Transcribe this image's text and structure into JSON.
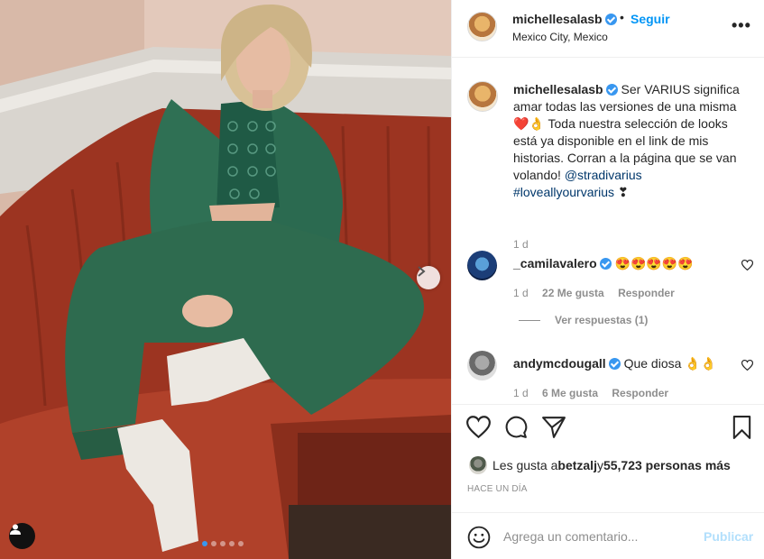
{
  "post": {
    "author": "michellesalasb",
    "location": "Mexico City, Mexico",
    "follow_label": "Seguir",
    "separator": "•",
    "more_label": "•••"
  },
  "caption": {
    "username": "michellesalasb",
    "text": " Ser VARIUS significa amar todas las versiones de una misma ❤️👌 Toda nuestra selección de looks está ya disponible en el link de mis historias. Corran a la página que se van volando! ",
    "mention": "@stradivarius",
    "hashtag": "#loveallyourvarius",
    "trailing_emoji": " ❣",
    "time": "1 d"
  },
  "comments": [
    {
      "username": "_camilavalero",
      "text": " 😍😍😍😍😍",
      "time": "1 d",
      "likes": "22 Me gusta",
      "reply_label": "Responder"
    },
    {
      "username": "andymcdougall",
      "text": " Que diosa 👌👌",
      "time": "1 d",
      "likes": "6 Me gusta",
      "reply_label": "Responder"
    }
  ],
  "view_replies_label": "Ver respuestas (1)",
  "likes": {
    "prefix": "Les gusta a ",
    "user": "betzalj",
    "joiner": " y ",
    "count": "55,723 personas más"
  },
  "timestamp": "HACE UN DÍA",
  "add_comment": {
    "placeholder": "Agrega un comentario...",
    "publish_label": "Publicar"
  },
  "colors": {
    "accent": "#0095f6",
    "verified": "#3897f0",
    "muted": "#8e8e8e",
    "publish_disabled": "#b2dffc",
    "sofa": "#a63a22",
    "outfit": "#2e6b4f"
  },
  "carousel": {
    "slides": 5,
    "active": 0
  },
  "icons": [
    "verified-badge-icon",
    "more-options-icon",
    "heart-icon",
    "comment-icon",
    "share-icon",
    "bookmark-icon",
    "emoji-icon",
    "next-arrow-icon",
    "tagged-user-icon"
  ]
}
